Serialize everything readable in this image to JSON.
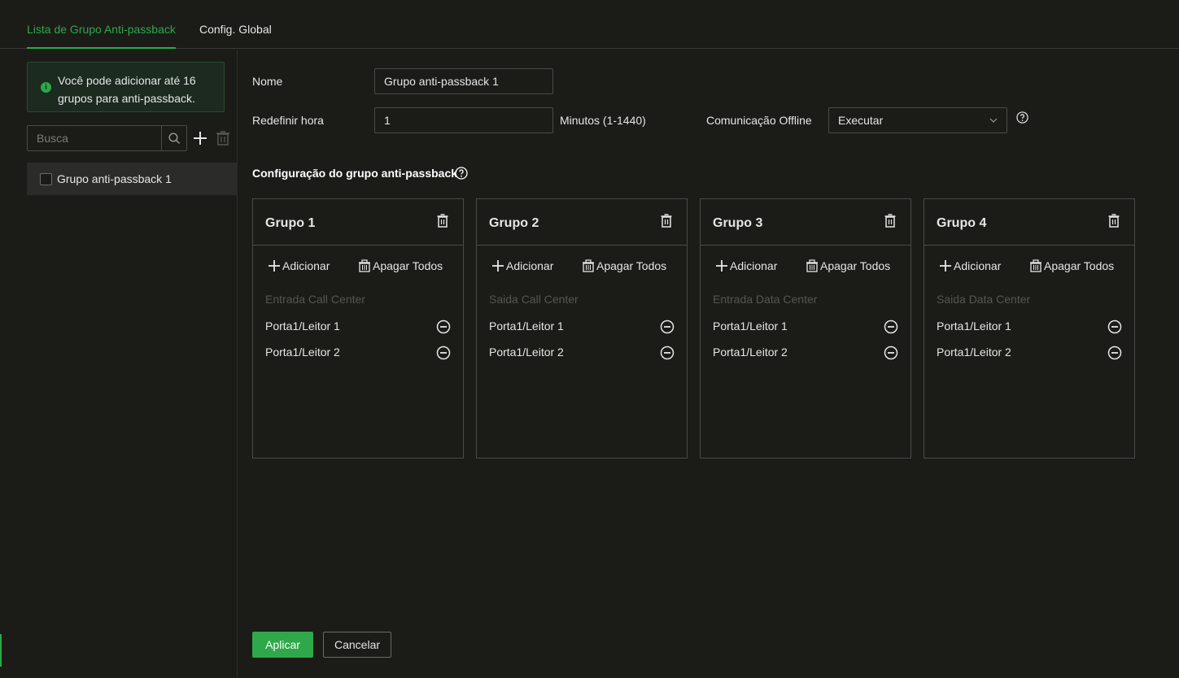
{
  "tabs": [
    {
      "label": "Lista de Grupo Anti-passback",
      "active": true
    },
    {
      "label": "Config. Global",
      "active": false
    }
  ],
  "sidebar": {
    "notice": "Você pode adicionar até 16 grupos para anti-passback.",
    "search_placeholder": "Busca",
    "items": [
      {
        "label": "Grupo anti-passback 1",
        "checked": false
      }
    ]
  },
  "form": {
    "name_label": "Nome",
    "name_value": "Grupo anti-passback 1",
    "reset_label": "Redefinir hora",
    "reset_value": "1",
    "reset_unit": "Minutos (1-1440)",
    "offline_label": "Comunicação Offline",
    "offline_value": "Executar"
  },
  "section_title": "Configuração do grupo anti-passback",
  "groups": [
    {
      "title": "Grupo 1",
      "add_label": "Adicionar",
      "clear_label": "Apagar Todos",
      "desc": "Entrada Call Center",
      "readers": [
        "Porta1/Leitor 1",
        "Porta1/Leitor 2"
      ]
    },
    {
      "title": "Grupo 2",
      "add_label": "Adicionar",
      "clear_label": "Apagar Todos",
      "desc": "Saida Call Center",
      "readers": [
        "Porta1/Leitor 1",
        "Porta1/Leitor 2"
      ]
    },
    {
      "title": "Grupo 3",
      "add_label": "Adicionar",
      "clear_label": "Apagar Todos",
      "desc": "Entrada Data Center",
      "readers": [
        "Porta1/Leitor 1",
        "Porta1/Leitor 2"
      ]
    },
    {
      "title": "Grupo 4",
      "add_label": "Adicionar",
      "clear_label": "Apagar Todos",
      "desc": "Saida Data Center",
      "readers": [
        "Porta1/Leitor 1",
        "Porta1/Leitor 2"
      ]
    }
  ],
  "buttons": {
    "apply": "Aplicar",
    "cancel": "Cancelar"
  },
  "colors": {
    "accent": "#2ea84a",
    "background": "#1b1c18",
    "border": "#4a4b48"
  }
}
